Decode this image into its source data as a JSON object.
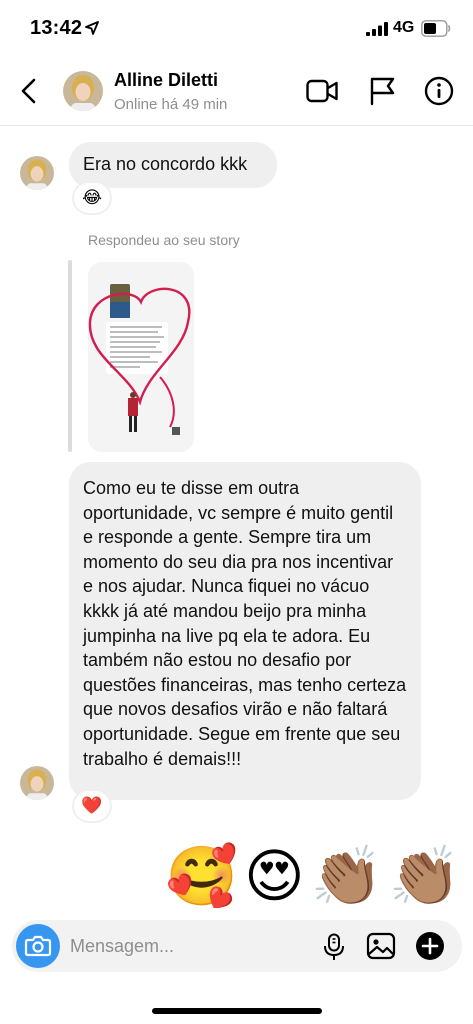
{
  "status_bar": {
    "time": "13:42",
    "network": "4G"
  },
  "header": {
    "contact_name": "Alline Diletti",
    "contact_status": "Online há 49 min",
    "icons": [
      "back-icon",
      "video-call-icon",
      "flag-icon",
      "info-icon"
    ]
  },
  "messages": [
    {
      "type": "text",
      "text": "Era no concordo kkk",
      "reaction": "😂"
    },
    {
      "type": "story_reply",
      "label": "Respondeu ao seu story"
    },
    {
      "type": "text",
      "text": "Como eu te disse em outra oportunidade, vc sempre é muito gentil e responde a gente. Sempre tira um momento do seu dia pra nos incentivar e nos ajudar. Nunca fiquei no vácuo kkkk já até mandou beijo pra minha jumpinha na live pq ela te adora. Eu também não estou no desafio por questões financeiras, mas tenho certeza que novos desafios virão e não faltará oportunidade. Segue em frente que seu trabalho é demais!!!",
      "reaction": "❤️"
    },
    {
      "type": "emoji",
      "emojis": [
        "🥰",
        "😍",
        "👏🏽",
        "👏🏽"
      ]
    }
  ],
  "composer": {
    "placeholder": "Mensagem...",
    "icons": [
      "camera-icon",
      "microphone-icon",
      "gallery-icon",
      "add-icon"
    ]
  },
  "colors": {
    "accent": "#3797f0",
    "bubble": "#efefef",
    "muted_text": "#8e8e8e"
  }
}
